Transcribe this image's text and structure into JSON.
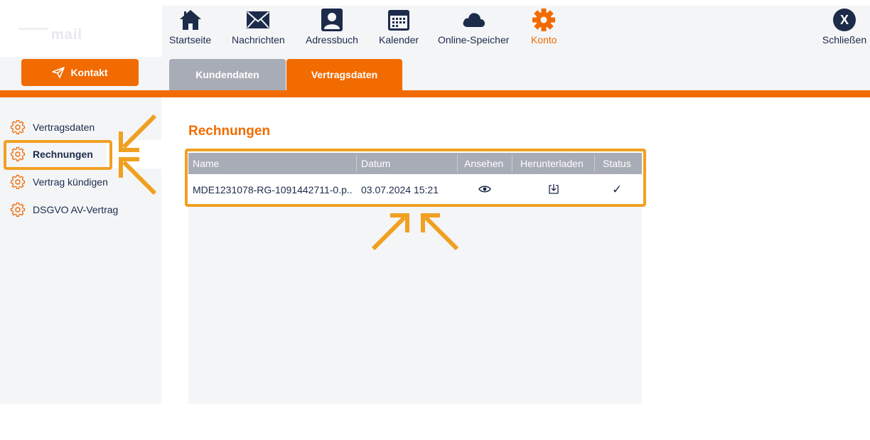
{
  "header": {
    "logo_text": "mail",
    "nav": [
      {
        "label": "Startseite",
        "icon": "home-icon"
      },
      {
        "label": "Nachrichten",
        "icon": "envelope-icon"
      },
      {
        "label": "Adressbuch",
        "icon": "contact-card-icon"
      },
      {
        "label": "Kalender",
        "icon": "calendar-icon"
      },
      {
        "label": "Online-Speicher",
        "icon": "cloud-icon"
      },
      {
        "label": "Konto",
        "icon": "gear-icon",
        "active": true
      }
    ],
    "close_label": "Schließen",
    "close_glyph": "X"
  },
  "kontakt_label": "Kontakt",
  "tabs": [
    {
      "label": "Kundendaten",
      "active": false
    },
    {
      "label": "Vertragsdaten",
      "active": true
    }
  ],
  "sidebar": {
    "items": [
      {
        "label": "Vertragsdaten",
        "active": false
      },
      {
        "label": "Rechnungen",
        "active": true
      },
      {
        "label": "Vertrag kündigen",
        "active": false
      },
      {
        "label": "DSGVO AV-Vertrag",
        "active": false
      }
    ]
  },
  "main": {
    "title": "Rechnungen",
    "table": {
      "headers": [
        "Name",
        "Datum",
        "Ansehen",
        "Herunterladen",
        "Status"
      ],
      "rows": [
        {
          "name": "MDE1231078-RG-1091442711-0.p...",
          "datum": "03.07.2024 15:21",
          "view_icon": "eye-icon",
          "download_icon": "download-icon",
          "status": "✓"
        }
      ]
    }
  },
  "colors": {
    "accent": "#f26b00",
    "navy": "#1c2b4a",
    "annotation": "#f0a021",
    "header_gray": "#a8acb6",
    "panel_gray": "#f4f5f7"
  }
}
